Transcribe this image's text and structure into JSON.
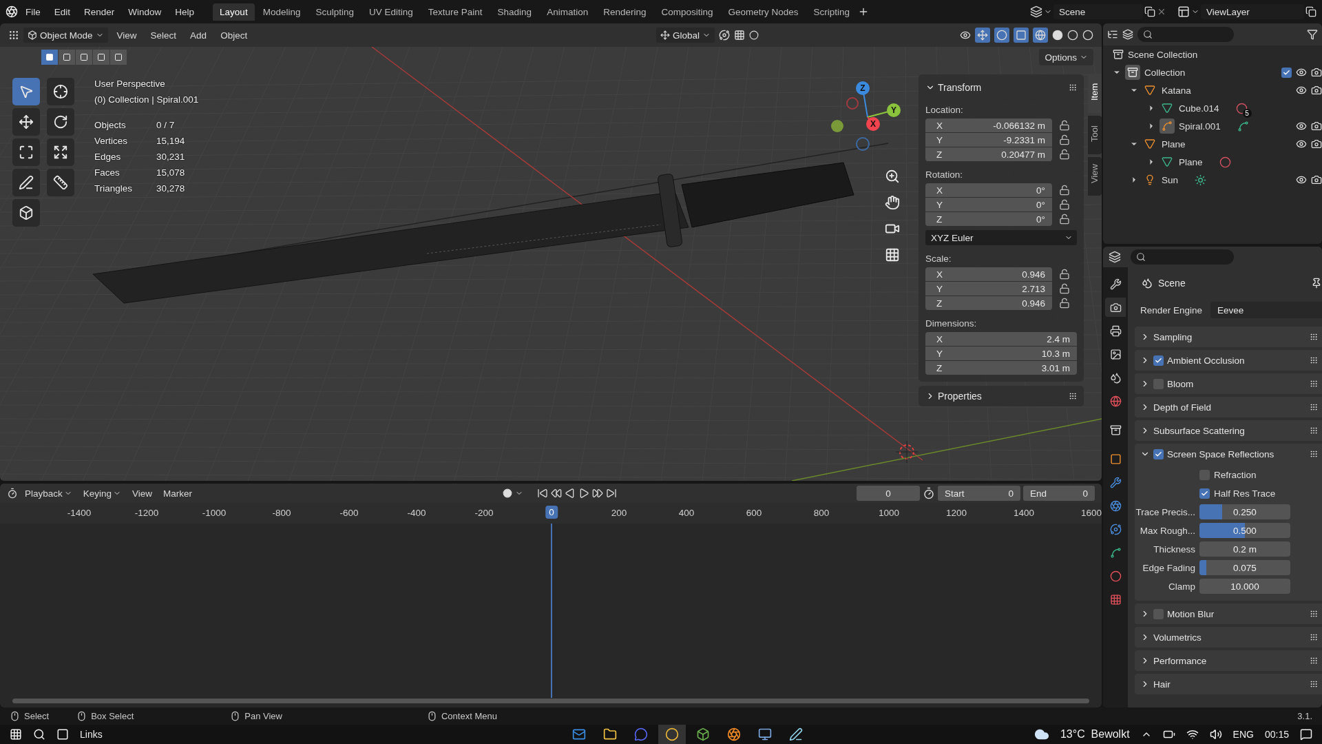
{
  "top_bar": {
    "menus": [
      "File",
      "Edit",
      "Render",
      "Window",
      "Help"
    ],
    "workspaces": [
      {
        "label": "Layout",
        "selected": true
      },
      {
        "label": "Modeling",
        "selected": false
      },
      {
        "label": "Sculpting",
        "selected": false
      },
      {
        "label": "UV Editing",
        "selected": false
      },
      {
        "label": "Texture Paint",
        "selected": false
      },
      {
        "label": "Shading",
        "selected": false
      },
      {
        "label": "Animation",
        "selected": false
      },
      {
        "label": "Rendering",
        "selected": false
      },
      {
        "label": "Compositing",
        "selected": false
      },
      {
        "label": "Geometry Nodes",
        "selected": false
      },
      {
        "label": "Scripting",
        "selected": false
      }
    ],
    "scene": "Scene",
    "view_layer": "ViewLayer"
  },
  "viewport": {
    "mode": "Object Mode",
    "menus": [
      "View",
      "Select",
      "Add",
      "Object"
    ],
    "orientation": "Global",
    "options": "Options",
    "select_modes": [
      {
        "selected": true
      },
      {
        "selected": false
      },
      {
        "selected": false
      },
      {
        "selected": false
      },
      {
        "selected": false
      }
    ],
    "tools": [
      {
        "kind": "select",
        "selected": true
      },
      {
        "kind": "cursor",
        "selected": false
      },
      {
        "kind": "move",
        "selected": false
      },
      {
        "kind": "rotate",
        "selected": false
      },
      {
        "kind": "scale",
        "selected": false
      },
      {
        "kind": "transform",
        "selected": false
      },
      {
        "kind": "annotate",
        "selected": false
      },
      {
        "kind": "measure",
        "selected": false
      },
      {
        "kind": "add_cube",
        "selected": false
      }
    ],
    "view_name": "User Perspective",
    "context": "(0) Collection | Spiral.001",
    "stats": [
      {
        "label": "Objects",
        "value": "0 / 7"
      },
      {
        "label": "Vertices",
        "value": "15,194"
      },
      {
        "label": "Edges",
        "value": "30,231"
      },
      {
        "label": "Faces",
        "value": "15,078"
      },
      {
        "label": "Triangles",
        "value": "30,278"
      }
    ],
    "gizmo_axes": [
      {
        "kind": "z",
        "label": "Z"
      },
      {
        "kind": "y",
        "label": "Y"
      },
      {
        "kind": "x",
        "label": "X"
      }
    ]
  },
  "sidebar": {
    "tabs": [
      {
        "label": "Item",
        "selected": true
      },
      {
        "label": "Tool",
        "selected": false
      },
      {
        "label": "View",
        "selected": false
      }
    ],
    "title": "Transform",
    "groups": [
      {
        "label": "Location:",
        "rows": [
          {
            "axis": "X",
            "value": "-0.066132 m",
            "locked": false
          },
          {
            "axis": "Y",
            "value": "-9.2331 m",
            "locked": false
          },
          {
            "axis": "Z",
            "value": "0.20477 m",
            "locked": false
          }
        ]
      },
      {
        "label": "Rotation:",
        "rows": [
          {
            "axis": "X",
            "value": "0°",
            "locked": false
          },
          {
            "axis": "Y",
            "value": "0°",
            "locked": false
          },
          {
            "axis": "Z",
            "value": "0°",
            "locked": false
          }
        ],
        "mode": "XYZ Euler"
      },
      {
        "label": "Scale:",
        "rows": [
          {
            "axis": "X",
            "value": "0.946",
            "locked": false
          },
          {
            "axis": "Y",
            "value": "2.713",
            "locked": false
          },
          {
            "axis": "Z",
            "value": "0.946",
            "locked": false
          }
        ]
      },
      {
        "label": "Dimensions:",
        "rows": [
          {
            "axis": "X",
            "value": "2.4 m"
          },
          {
            "axis": "Y",
            "value": "10.3 m"
          },
          {
            "axis": "Z",
            "value": "3.01 m"
          }
        ]
      }
    ],
    "properties": "Properties"
  },
  "timeline": {
    "menus": [
      {
        "label": "Playback",
        "dropdown": true
      },
      {
        "label": "Keying",
        "dropdown": true
      },
      {
        "label": "View",
        "dropdown": false
      },
      {
        "label": "Marker",
        "dropdown": false
      }
    ],
    "current_frame": "0",
    "start_label": "Start",
    "start": "0",
    "end_label": "End",
    "end": "0",
    "ticks": [
      {
        "label": "-1400",
        "current": false
      },
      {
        "label": "-1200",
        "current": false
      },
      {
        "label": "-1000",
        "current": false
      },
      {
        "label": "-800",
        "current": false
      },
      {
        "label": "-600",
        "current": false
      },
      {
        "label": "-400",
        "current": false
      },
      {
        "label": "-200",
        "current": false
      },
      {
        "label": "0",
        "current": true
      },
      {
        "label": "200",
        "current": false
      },
      {
        "label": "400",
        "current": false
      },
      {
        "label": "600",
        "current": false
      },
      {
        "label": "800",
        "current": false
      },
      {
        "label": "1000",
        "current": false
      },
      {
        "label": "1200",
        "current": false
      },
      {
        "label": "1400",
        "current": false
      },
      {
        "label": "1600",
        "current": false
      }
    ]
  },
  "outliner": {
    "root": "Scene Collection",
    "items": [
      {
        "label": "Collection",
        "kind": "collection",
        "expanded": true,
        "active": true,
        "checked": true,
        "visible": true,
        "children": [
          {
            "label": "Katana",
            "kind": "object",
            "expanded": true,
            "active": false,
            "visible": true,
            "children": [
              {
                "label": "Cube.014",
                "kind": "mesh",
                "expanded": false,
                "active": false,
                "extra": {
                  "kind": "material",
                  "count": "5"
                }
              },
              {
                "label": "Spiral.001",
                "kind": "curve",
                "expanded": false,
                "active": true,
                "visible": true,
                "extra": {
                  "kind": "curve_data"
                }
              }
            ]
          },
          {
            "label": "Plane",
            "kind": "object",
            "expanded": true,
            "active": false,
            "visible": true,
            "children": [
              {
                "label": "Plane",
                "kind": "mesh",
                "expanded": false,
                "active": false,
                "extra": {
                  "kind": "material"
                }
              }
            ]
          },
          {
            "label": "Sun",
            "kind": "light",
            "expanded": false,
            "active": false,
            "visible": true,
            "extra": {
              "kind": "light_data"
            }
          }
        ]
      }
    ]
  },
  "properties": {
    "tabs": [
      {
        "kind": "tool",
        "selected": false
      },
      {
        "kind": "render",
        "selected": true
      },
      {
        "kind": "output",
        "selected": false
      },
      {
        "kind": "view_layer",
        "selected": false
      },
      {
        "kind": "scene",
        "selected": false
      },
      {
        "kind": "world",
        "selected": false
      },
      {
        "kind": "collection",
        "selected": false
      },
      {
        "kind": "object",
        "selected": false
      },
      {
        "kind": "modifiers",
        "selected": false
      },
      {
        "kind": "particles",
        "selected": false
      },
      {
        "kind": "physics",
        "selected": false
      },
      {
        "kind": "data",
        "selected": false
      },
      {
        "kind": "material",
        "selected": false
      },
      {
        "kind": "texture",
        "selected": false
      }
    ],
    "context": "Scene",
    "engine_label": "Render Engine",
    "engine": "Eevee",
    "panels": [
      {
        "label": "Sampling",
        "kind": "plain",
        "expanded": false
      },
      {
        "label": "Ambient Occlusion",
        "kind": "toggle",
        "checked": true,
        "expanded": false
      },
      {
        "label": "Bloom",
        "kind": "toggle",
        "checked": false,
        "expanded": false
      },
      {
        "label": "Depth of Field",
        "kind": "plain",
        "expanded": false
      },
      {
        "label": "Subsurface Scattering",
        "kind": "plain",
        "expanded": false
      },
      {
        "label": "Screen Space Reflections",
        "kind": "toggle",
        "checked": true,
        "expanded": true,
        "fields": [
          {
            "kind": "checkbox",
            "label": "Refraction",
            "checked": false
          },
          {
            "kind": "checkbox",
            "label": "Half Res Trace",
            "checked": true
          },
          {
            "kind": "slider",
            "label": "Trace Precis...",
            "value": "0.250",
            "level": 0.25
          },
          {
            "kind": "slider",
            "label": "Max Rough...",
            "value": "0.500",
            "level": 0.5
          },
          {
            "kind": "number",
            "label": "Thickness",
            "value": "0.2 m"
          },
          {
            "kind": "slider",
            "label": "Edge Fading",
            "value": "0.075",
            "level": 0.075
          },
          {
            "kind": "number",
            "label": "Clamp",
            "value": "10.000"
          }
        ]
      },
      {
        "label": "Motion Blur",
        "kind": "toggle",
        "checked": false,
        "expanded": false
      },
      {
        "label": "Volumetrics",
        "kind": "plain",
        "expanded": false
      },
      {
        "label": "Performance",
        "kind": "plain",
        "expanded": false
      },
      {
        "label": "Hair",
        "kind": "plain",
        "expanded": false
      }
    ]
  },
  "status_bar": {
    "hints": [
      {
        "label": "Select"
      },
      {
        "label": "Box Select"
      },
      {
        "label": "Pan View"
      },
      {
        "label": "Context Menu"
      }
    ],
    "version": "3.1."
  },
  "taskbar": {
    "search_label": "Links",
    "apps": [
      {
        "kind": "mail",
        "selected": false
      },
      {
        "kind": "folder",
        "selected": false
      },
      {
        "kind": "chat",
        "selected": false
      },
      {
        "kind": "browser",
        "selected": true
      },
      {
        "kind": "game",
        "selected": false
      },
      {
        "kind": "blender",
        "selected": false
      },
      {
        "kind": "tool",
        "selected": false
      },
      {
        "kind": "pen",
        "selected": false
      }
    ],
    "weather": "13°C  Bewolkt",
    "language": "ENG",
    "time": "00:15"
  }
}
